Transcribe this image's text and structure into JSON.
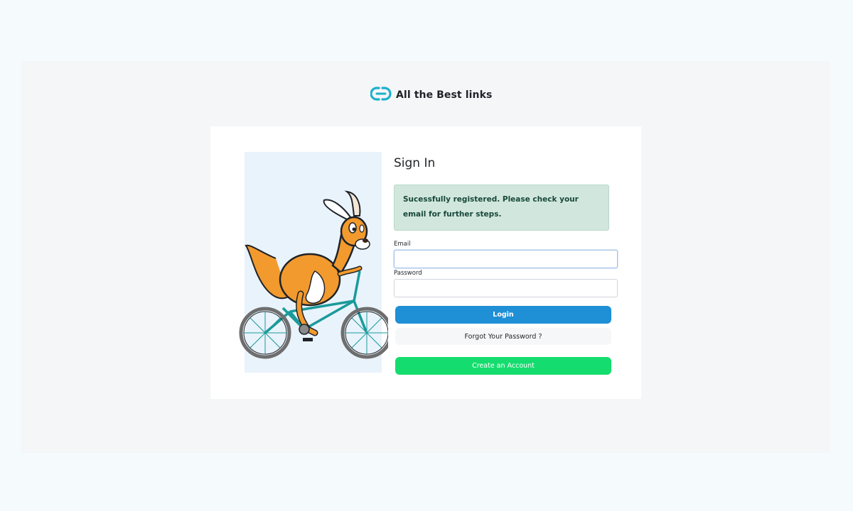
{
  "brand": {
    "name": "All the Best links",
    "icon": "link-logo-icon",
    "color": "#1bb1cc"
  },
  "signin": {
    "title": "Sign In",
    "alert": "Sucessfully registered. Please check your email for further steps.",
    "email_label": "Email",
    "email_value": "",
    "password_label": "Password",
    "password_value": "",
    "login_label": "Login",
    "forgot_label": "Forgot Your Password ?",
    "create_label": "Create an Account"
  },
  "illustration": {
    "icon": "kangaroo-bicycle-illustration"
  },
  "colors": {
    "primary": "#1f8fd6",
    "success": "#15dc6e",
    "alert_bg": "#d1e7dd",
    "alert_text": "#18473a"
  }
}
